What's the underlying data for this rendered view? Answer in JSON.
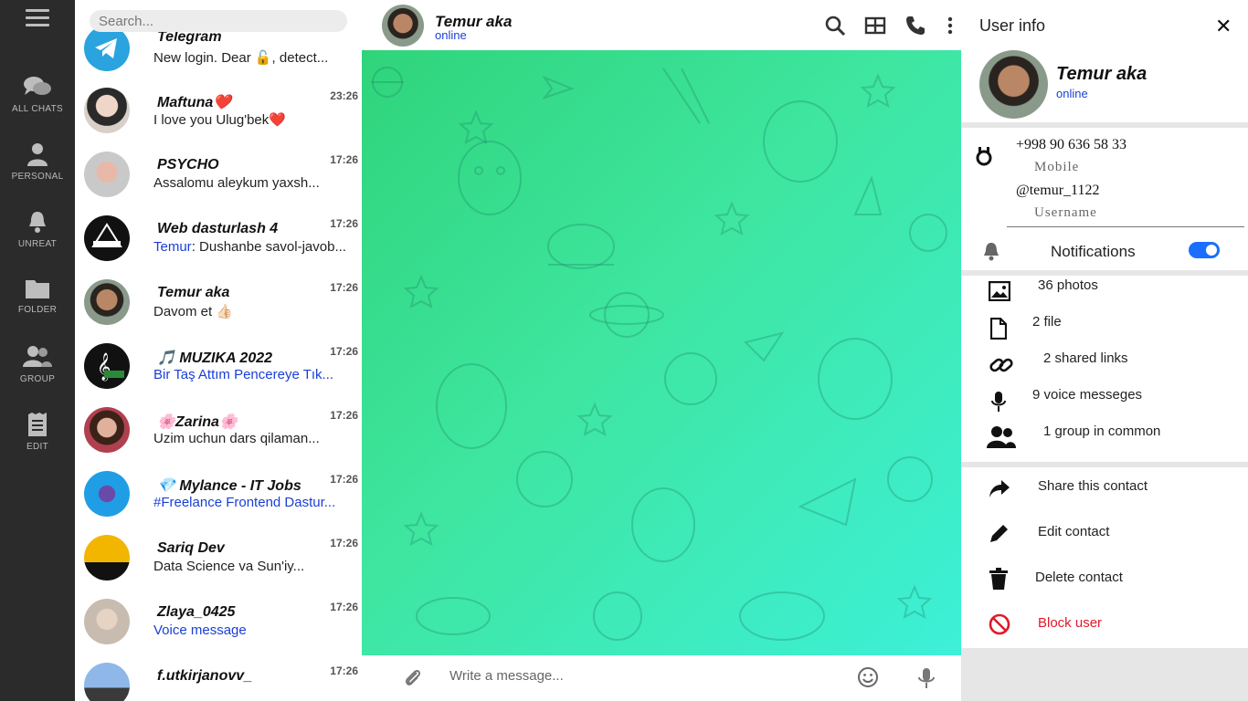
{
  "rail": {
    "items": [
      {
        "label": "ALL CHATS",
        "icon": "chats-icon"
      },
      {
        "label": "PERSONAL",
        "icon": "person-icon"
      },
      {
        "label": "UNREAT",
        "icon": "bell-icon"
      },
      {
        "label": "FOLDER",
        "icon": "folder-icon"
      },
      {
        "label": "GROUP",
        "icon": "group-icon"
      },
      {
        "label": "EDIT",
        "icon": "edit-icon"
      }
    ]
  },
  "search": {
    "placeholder": "Search..."
  },
  "chats": [
    {
      "name": "Telegram",
      "message": "New login. Dear 🔓, detect...",
      "time": ""
    },
    {
      "name": "Maftuna❤️",
      "message": "I love you Ulug'bek❤️",
      "time": "23:26"
    },
    {
      "name": "PSYCHO",
      "message": "Assalomu aleykum yaxsh...",
      "time": "17:26"
    },
    {
      "name": "Web dasturlash 4",
      "sender": "Temur",
      "message": ": Dushanbe savol-javob...",
      "time": "17:26"
    },
    {
      "name": "Temur aka",
      "message": "Davom et 👍🏻",
      "time": "17:26"
    },
    {
      "name": "🎵 MUZIKA 2022",
      "message": "Bir Taş Attım Pencereye Tık...",
      "time": "17:26",
      "blue": true
    },
    {
      "name": "🌸Zarina🌸",
      "message": "Uzim uchun dars qilaman...",
      "time": "17:26"
    },
    {
      "name": "💎 Mylance - IT Jobs",
      "message": "#Freelance Frontend Dastur...",
      "time": "17:26",
      "blue": true
    },
    {
      "name": "Sariq Dev",
      "message": "Data Science va Sun'iy...",
      "time": "17:26"
    },
    {
      "name": "Zlaya_0425",
      "message": "Voice message",
      "time": "17:26",
      "blue": true
    },
    {
      "name": "f.utkirjanovv_",
      "message": "",
      "time": "17:26"
    }
  ],
  "conversation": {
    "title": "Temur aka",
    "status": "online",
    "composer_placeholder": "Write a message..."
  },
  "info": {
    "title": "User info",
    "name": "Temur aka",
    "status": "online",
    "phone": "+998 90 636 58 33",
    "phone_label": "Mobile",
    "username": "@temur_1122",
    "username_label": "Username",
    "notifications_label": "Notifications",
    "notifications_on": true,
    "media": [
      {
        "label": "36 photos",
        "icon": "image-icon"
      },
      {
        "label": "2 file",
        "icon": "file-icon"
      },
      {
        "label": "2 shared links",
        "icon": "link-icon"
      },
      {
        "label": "9 voice messeges",
        "icon": "mic-icon"
      },
      {
        "label": "1 group in common",
        "icon": "group-icon"
      }
    ],
    "actions": [
      {
        "label": "Share this contact",
        "icon": "share-icon"
      },
      {
        "label": "Edit contact",
        "icon": "pencil-icon"
      },
      {
        "label": "Delete contact",
        "icon": "trash-icon"
      },
      {
        "label": "Block user",
        "icon": "block-icon",
        "danger": true
      }
    ]
  },
  "colors": {
    "accent": "#1a3fd6",
    "danger": "#e0192b",
    "rail": "#2b2b2b",
    "toggle": "#1a6fff"
  }
}
